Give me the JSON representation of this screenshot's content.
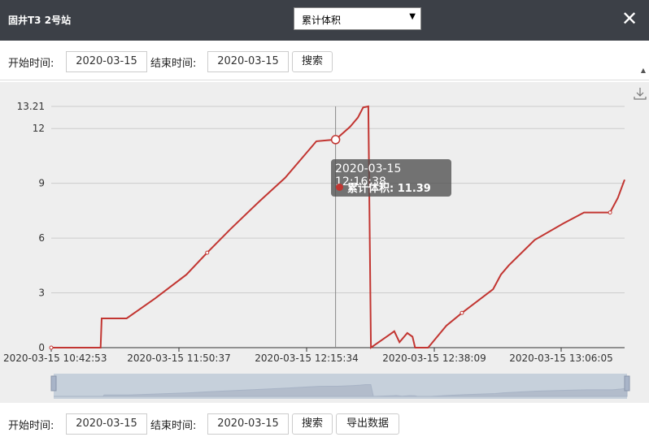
{
  "header": {
    "title": "固井T3 2号站",
    "select_value": "累计体积"
  },
  "toolbar_top": {
    "start_label": "开始时间:",
    "start_value": "2020-03-15",
    "end_label": "结束时间:",
    "end_value": "2020-03-15",
    "search_label": "搜索"
  },
  "toolbar_bottom": {
    "start_label": "开始时间:",
    "start_value": "2020-03-15",
    "end_label": "结束时间:",
    "end_value": "2020-03-15",
    "search_label": "搜索",
    "export_label": "导出数据"
  },
  "tooltip": {
    "time": "2020-03-15 12:16:38",
    "series_label": "累计体积: 11.39"
  },
  "colors": {
    "series": "#c23531",
    "header_bg": "#3c4047"
  },
  "chart_data": {
    "type": "line",
    "ylim": [
      0,
      13.21
    ],
    "y_ticks": [
      "0",
      "3",
      "6",
      "9",
      "12",
      "13.21"
    ],
    "x_tick_labels": [
      "2020-03-15 10:42:53",
      "2020-03-15 11:50:37",
      "2020-03-15 12:15:34",
      "2020-03-15 12:38:09",
      "2020-03-15 13:06:05"
    ],
    "series": [
      {
        "values": [
          [
            0,
            0
          ],
          [
            0.095,
            0
          ],
          [
            0.097,
            1.6
          ],
          [
            0.145,
            1.6
          ],
          [
            0.2,
            2.7
          ],
          [
            0.26,
            4.0
          ],
          [
            0.3,
            5.2
          ],
          [
            0.345,
            6.5
          ],
          [
            0.4,
            8.0
          ],
          [
            0.45,
            9.3
          ],
          [
            0.51,
            11.3
          ],
          [
            0.53,
            11.35
          ],
          [
            0.547,
            11.39
          ],
          [
            0.575,
            12.1
          ],
          [
            0.59,
            12.6
          ],
          [
            0.6,
            13.15
          ],
          [
            0.61,
            13.21
          ],
          [
            0.615,
            0
          ],
          [
            0.65,
            0.7
          ],
          [
            0.66,
            0.9
          ],
          [
            0.67,
            0.3
          ],
          [
            0.685,
            0.8
          ],
          [
            0.695,
            0.6
          ],
          [
            0.7,
            0
          ],
          [
            0.725,
            0
          ],
          [
            0.76,
            1.2
          ],
          [
            0.79,
            1.9
          ],
          [
            0.85,
            3.2
          ],
          [
            0.865,
            4.0
          ],
          [
            0.88,
            4.5
          ],
          [
            0.93,
            5.9
          ],
          [
            0.985,
            6.8
          ],
          [
            1.025,
            7.4
          ],
          [
            1.075,
            7.4
          ],
          [
            1.09,
            8.2
          ],
          [
            1.103,
            9.2
          ]
        ]
      }
    ],
    "highlight_index": 12
  }
}
